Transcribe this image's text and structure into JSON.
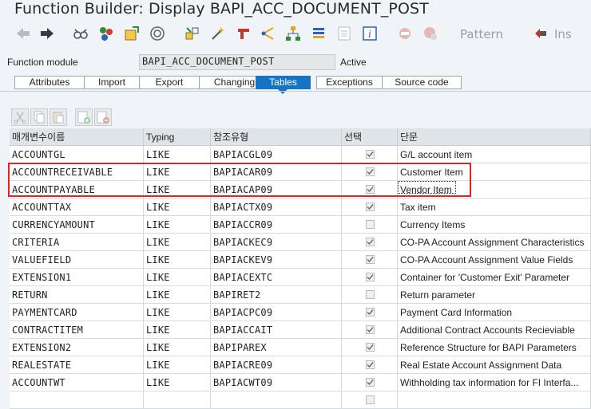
{
  "window": {
    "title": "Function Builder: Display BAPI_ACC_DOCUMENT_POST"
  },
  "toolbar": {
    "icons": [
      "back-icon",
      "forward-icon",
      "glasses-icon",
      "display-change-icon",
      "activate-icon",
      "where-used-icon",
      "object-list-icon",
      "test-icon",
      "magic-wand-icon",
      "pretty-printer-icon",
      "navigation-icon",
      "hierarchy-icon",
      "stack-icon",
      "document-icon",
      "info-icon",
      "breakpoint-icon",
      "external-breakpoint-icon",
      "insert-icon"
    ],
    "pattern_label": "Pattern",
    "insert_label": "Ins"
  },
  "header": {
    "function_module_label": "Function module",
    "function_module_value": "BAPI_ACC_DOCUMENT_POST",
    "status": "Active"
  },
  "tabs": [
    {
      "label": "Attributes",
      "active": false
    },
    {
      "label": "Import",
      "active": false
    },
    {
      "label": "Export",
      "active": false
    },
    {
      "label": "Changing",
      "active": false
    },
    {
      "label": "Tables",
      "active": true
    },
    {
      "label": "Exceptions",
      "active": false
    },
    {
      "label": "Source code",
      "active": false
    }
  ],
  "table_toolbar": {
    "icons": [
      "cut-icon",
      "copy-icon",
      "paste-icon",
      "insert-row-icon",
      "delete-row-icon"
    ]
  },
  "table": {
    "headers": [
      "매개변수이름",
      "Typing",
      "참조유형",
      "선택",
      "단문"
    ],
    "rows": [
      {
        "name": "ACCOUNTGL",
        "typing": "LIKE",
        "ref": "BAPIACGL09",
        "optional": true,
        "desc": "G/L account item"
      },
      {
        "name": "ACCOUNTRECEIVABLE",
        "typing": "LIKE",
        "ref": "BAPIACAR09",
        "optional": true,
        "desc": "Customer Item"
      },
      {
        "name": "ACCOUNTPAYABLE",
        "typing": "LIKE",
        "ref": "BAPIACAP09",
        "optional": true,
        "desc": "Vendor Item"
      },
      {
        "name": "ACCOUNTTAX",
        "typing": "LIKE",
        "ref": "BAPIACTX09",
        "optional": true,
        "desc": "Tax item"
      },
      {
        "name": "CURRENCYAMOUNT",
        "typing": "LIKE",
        "ref": "BAPIACCR09",
        "optional": false,
        "desc": "Currency Items"
      },
      {
        "name": "CRITERIA",
        "typing": "LIKE",
        "ref": "BAPIACKEC9",
        "optional": true,
        "desc": "CO-PA Account Assignment Characteristics"
      },
      {
        "name": "VALUEFIELD",
        "typing": "LIKE",
        "ref": "BAPIACKEV9",
        "optional": true,
        "desc": "CO-PA Account Assignment Value Fields"
      },
      {
        "name": "EXTENSION1",
        "typing": "LIKE",
        "ref": "BAPIACEXTC",
        "optional": true,
        "desc": "Container for 'Customer Exit' Parameter"
      },
      {
        "name": "RETURN",
        "typing": "LIKE",
        "ref": "BAPIRET2",
        "optional": false,
        "desc": "Return parameter"
      },
      {
        "name": "PAYMENTCARD",
        "typing": "LIKE",
        "ref": "BAPIACPC09",
        "optional": true,
        "desc": "Payment Card Information"
      },
      {
        "name": "CONTRACTITEM",
        "typing": "LIKE",
        "ref": "BAPIACCAIT",
        "optional": true,
        "desc": "Additional Contract Accounts Recieviable"
      },
      {
        "name": "EXTENSION2",
        "typing": "LIKE",
        "ref": "BAPIPAREX",
        "optional": true,
        "desc": "Reference Structure for BAPI Parameters"
      },
      {
        "name": "REALESTATE",
        "typing": "LIKE",
        "ref": "BAPIACRE09",
        "optional": true,
        "desc": "Real Estate Account Assignment Data"
      },
      {
        "name": "ACCOUNTWT",
        "typing": "LIKE",
        "ref": "BAPIACWT09",
        "optional": true,
        "desc": "Withholding tax information for FI Interfa..."
      },
      {
        "name": "",
        "typing": "",
        "ref": "",
        "optional": false,
        "desc": ""
      }
    ]
  }
}
